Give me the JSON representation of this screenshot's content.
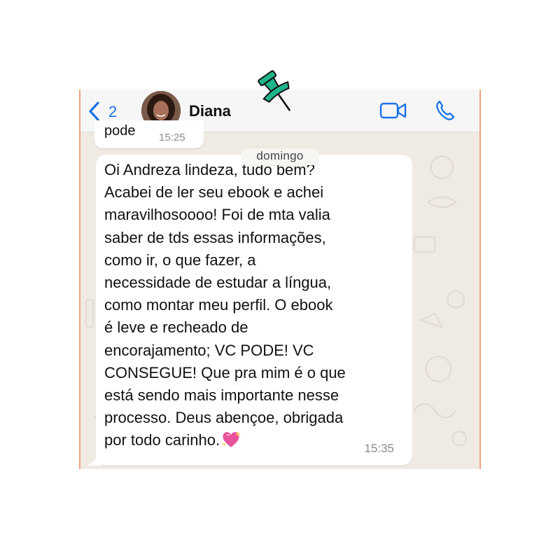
{
  "header": {
    "back_count": "2",
    "contact_name": "Diana"
  },
  "previous_message": {
    "text": "pode",
    "time": "15:25"
  },
  "day_separator": "domingo",
  "message": {
    "text": "Oi Andreza lindeza, tudo bem?\nAcabei de ler seu ebook e achei\nmaravilhosoooo! Foi de mta valia\nsaber de tds essas informações,\ncomo ir, o que fazer,  a\nnecessidade de estudar a língua,\ncomo montar meu perfil. O ebook\né leve e recheado de\nencorajamento; VC PODE! VC\nCONSEGUE! Que pra mim é o que\nestá sendo mais importante nesse\nprocesso. Deus abençoe, obrigada\npor todo carinho.",
    "emoji": "sparkling-heart",
    "time": "15:35"
  },
  "colors": {
    "accent": "#1a73e8",
    "chat_background": "#efeae2",
    "bubble": "#ffffff",
    "pin": "#1fb58c",
    "heart": "#e8539c"
  }
}
